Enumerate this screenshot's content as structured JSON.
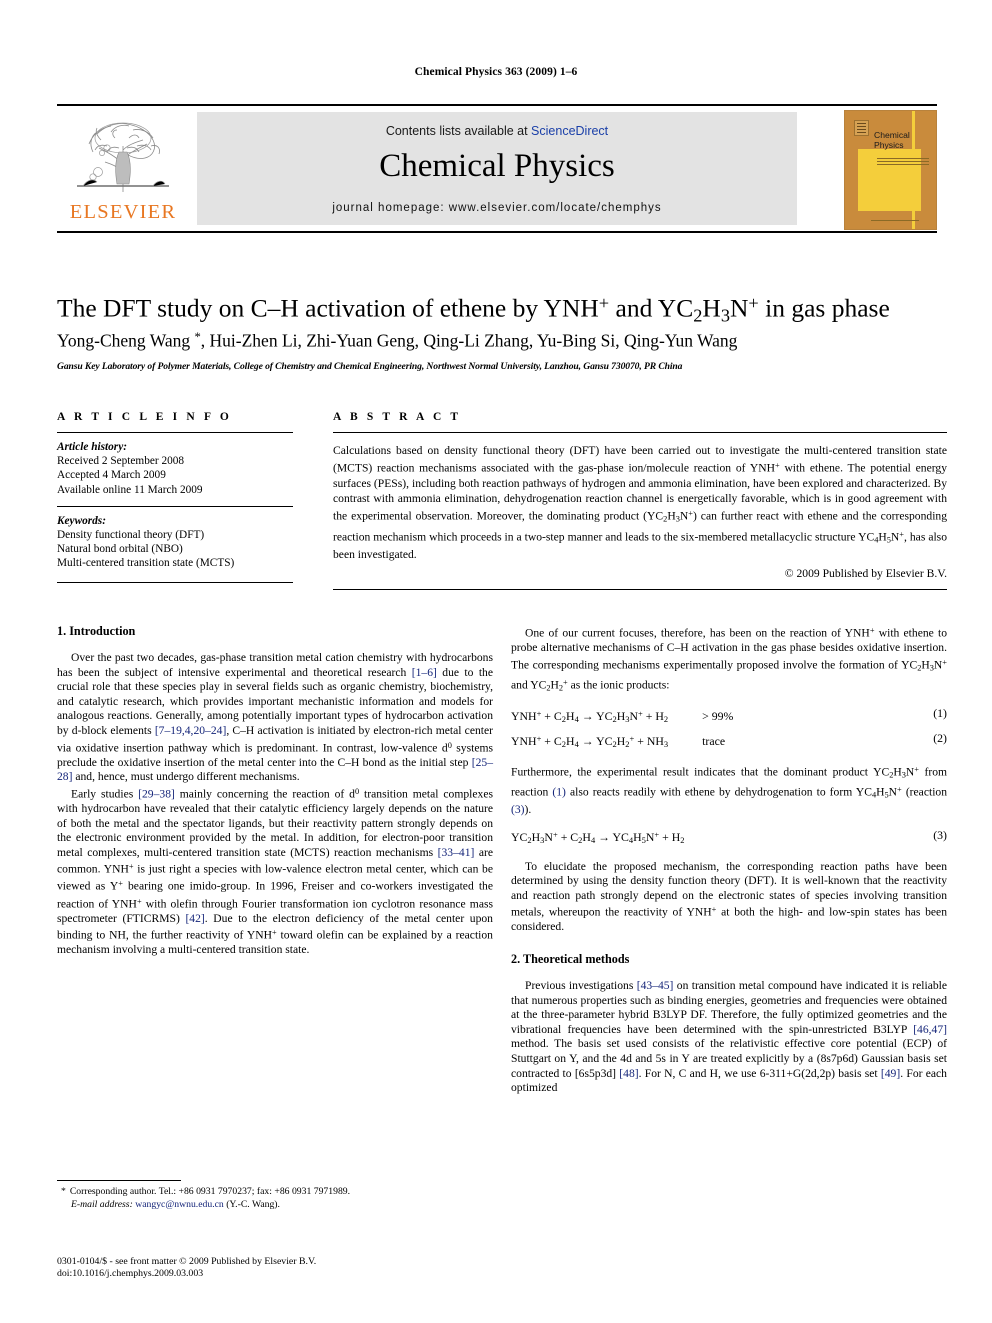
{
  "running_head": "Chemical Physics 363 (2009) 1–6",
  "masthead": {
    "contents_prefix": "Contents lists available at ",
    "sciencedirect": "ScienceDirect",
    "journal_title": "Chemical Physics",
    "homepage": "journal homepage: www.elsevier.com/locate/chemphys",
    "publisher_name": "ELSEVIER",
    "publisher_logo": "elsevier-tree-logo",
    "cover_title": "Chemical Physics",
    "accent_orange": "#E87722",
    "accent_blue": "#1a3fa8",
    "band_gray": "#e3e3e3",
    "cover_bg": "#C98B3C",
    "cover_panel": "#F4CE3B"
  },
  "article": {
    "title_html": "The DFT study on C–H activation of ethene by YNH<sup>+</sup> and YC<sub>2</sub>H<sub>3</sub>N<sup>+</sup> in gas phase",
    "authors_html": "Yong-Cheng Wang <sup>*</sup>, Hui-Zhen Li, Zhi-Yuan Geng, Qing-Li Zhang, Yu-Bing Si, Qing-Yun Wang",
    "affiliation": "Gansu Key Laboratory of Polymer Materials, College of Chemistry and Chemical Engineering, Northwest Normal University, Lanzhou, Gansu 730070, PR China"
  },
  "info": {
    "heading": "A R T I C L E   I N F O",
    "history_label": "Article history:",
    "history": [
      "Received 2 September 2008",
      "Accepted 4 March 2009",
      "Available online 11 March 2009"
    ],
    "keywords_label": "Keywords:",
    "keywords": [
      "Density functional theory (DFT)",
      "Natural bond orbital (NBO)",
      "Multi-centered transition state (MCTS)"
    ]
  },
  "abstract": {
    "heading": "A B S T R A C T",
    "text_html": "Calculations based on density functional theory (DFT) have been carried out to investigate the multi-centered transition state (MCTS) reaction mechanisms associated with the gas-phase ion/molecule reaction of YNH<sup>+</sup> with ethene. The potential energy surfaces (PESs), including both reaction pathways of hydrogen and ammonia elimination, have been explored and characterized. By contrast with ammonia elimination, dehydrogenation reaction channel is energetically favorable, which is in good agreement with the experimental observation. Moreover, the dominating product (YC<sub>2</sub>H<sub>3</sub>N<sup>+</sup>) can further react with ethene and the corresponding reaction mechanism which proceeds in a two-step manner and leads to the six-membered metallacyclic structure YC<sub>4</sub>H<sub>5</sub>N<sup>+</sup>, has also been investigated.",
    "copyright": "© 2009 Published by Elsevier B.V."
  },
  "body": {
    "section1_heading": "1. Introduction",
    "p1_html": "Over the past two decades, gas-phase transition metal cation chemistry with hydrocarbons has been the subject of intensive experimental and theoretical research <span class=\"ref\">[1–6]</span> due to the crucial role that these species play in several fields such as organic chemistry, biochemistry, and catalytic research, which provides important mechanistic information and models for analogous reactions. Generally, among potentially important types of hydrocarbon activation by d-block elements <span class=\"ref\">[7–19,4,20–24]</span>, C–H activation is initiated by electron-rich metal center via oxidative insertion pathway which is predominant. In contrast, low-valence d<sup>0</sup> systems preclude the oxidative insertion of the metal center into the C–H bond as the initial step <span class=\"ref\">[25–28]</span> and, hence, must undergo different mechanisms.",
    "p2_html": "Early studies <span class=\"ref\">[29–38]</span> mainly concerning the reaction of d<sup>0</sup> transition metal complexes with hydrocarbon have revealed that their catalytic efficiency largely depends on the nature of both the metal and the spectator ligands, but their reactivity pattern strongly depends on the electronic environment provided by the metal. In addition, for electron-poor transition metal complexes, multi-centered transition state (MCTS) reaction mechanisms <span class=\"ref\">[33–41]</span> are common. YNH<sup>+</sup> is just right a species with low-valence electron metal center, which can be viewed as Y<sup>+</sup> bearing one imido-group. In 1996, Freiser and co-workers investigated the reaction of YNH<sup>+</sup> with olefin through Fourier transformation ion cyclotron resonance mass spectrometer (FTICRMS) <span class=\"ref\">[42]</span>. Due to the electron deficiency of the metal center upon binding to NH, the further reactivity of YNH<sup>+</sup> toward olefin can be explained by a reaction mechanism involving a multi-centered transition state.",
    "p3_html": "One of our current focuses, therefore, has been on the reaction of YNH<sup>+</sup> with ethene to probe alternative mechanisms of C–H activation in the gas phase besides oxidative insertion. The corresponding mechanisms experimentally proposed involve the formation of YC<sub>2</sub>H<sub>3</sub>N<sup>+</sup> and YC<sub>2</sub>H<sub>2</sub><sup>+</sup> as the ionic products:",
    "eq1_html": "YNH<sup>+</sup> + C<sub>2</sub>H<sub>4</sub> → YC<sub>2</sub>H<sub>3</sub>N<sup>+</sup> + H<sub>2</sub>",
    "eq1_cond": "> 99%",
    "eq1_num": "(1)",
    "eq2_html": "YNH<sup>+</sup> + C<sub>2</sub>H<sub>4</sub> → YC<sub>2</sub>H<sub>2</sub><sup>+</sup> + NH<sub>3</sub>",
    "eq2_cond": "trace",
    "eq2_num": "(2)",
    "p4_html": "Furthermore, the experimental result indicates that the dominant product YC<sub>2</sub>H<sub>3</sub>N<sup>+</sup> from reaction <span class=\"ref\">(1)</span> also reacts readily with ethene by dehydrogenation to form YC<sub>4</sub>H<sub>5</sub>N<sup>+</sup> (reaction <span class=\"ref\">(3)</span>).",
    "eq3_html": "YC<sub>2</sub>H<sub>3</sub>N<sup>+</sup> + C<sub>2</sub>H<sub>4</sub> → YC<sub>4</sub>H<sub>5</sub>N<sup>+</sup> + H<sub>2</sub>",
    "eq3_num": "(3)",
    "p5_html": "To elucidate the proposed mechanism, the corresponding reaction paths have been determined by using the density function theory (DFT). It is well-known that the reactivity and reaction path strongly depend on the electronic states of species involving transition metals, whereupon the reactivity of YNH<sup>+</sup> at both the high- and low-spin states has been considered.",
    "section2_heading": "2. Theoretical methods",
    "p6_html": "Previous investigations <span class=\"ref\">[43–45]</span> on transition metal compound have indicated it is reliable that numerous properties such as binding energies, geometries and frequencies were obtained at the three-parameter hybrid B3LYP DF. Therefore, the fully optimized geometries and the vibrational frequencies have been determined with the spin-unrestricted B3LYP <span class=\"ref\">[46,47]</span> method. The basis set used consists of the relativistic effective core potential (ECP) of Stuttgart on Y, and the 4d and 5s in Y are treated explicitly by a (8s7p6d) Gaussian basis set contracted to [6s5p3d] <span class=\"ref\">[48]</span>. For N, C and H, we use 6-311+G(2d,2p) basis set <span class=\"ref\">[49]</span>. For each optimized"
  },
  "footnote": {
    "star": "*",
    "line1": "Corresponding author. Tel.: +86 0931 7970237; fax: +86 0931 7971989.",
    "email_label": "E-mail address:",
    "email": "wangyc@nwnu.edu.cn",
    "email_owner": "(Y.-C. Wang)."
  },
  "page_footer": {
    "line1": "0301-0104/$ - see front matter © 2009 Published by Elsevier B.V.",
    "line2": "doi:10.1016/j.chemphys.2009.03.003"
  }
}
